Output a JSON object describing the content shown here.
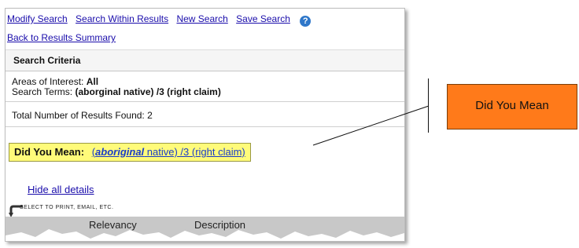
{
  "toolbar": {
    "modify_search": "Modify Search",
    "search_within": "Search Within Results",
    "new_search": "New Search",
    "save_search": "Save Search",
    "help_glyph": "?"
  },
  "back_link": "Back to Results Summary",
  "criteria": {
    "heading": "Search Criteria",
    "areas_label": "Areas of Interest:",
    "areas_value": "All",
    "terms_label": "Search Terms:",
    "terms_value": "(aborginal native) /3 (right claim)"
  },
  "results": {
    "total_text": "Total Number of Results Found: 2"
  },
  "did_you_mean": {
    "label": "Did You Mean:",
    "suggestion_open": "(",
    "corrected_word": "aboriginal",
    "suggestion_rest": " native) /3 (right claim)"
  },
  "hide_details": "Hide all details",
  "select_hint": "SELECT TO PRINT, EMAIL, ETC.",
  "grid_headers": {
    "relevancy": "Relevancy",
    "description": "Description"
  },
  "callout": {
    "text": "Did You Mean"
  },
  "colors": {
    "link": "#1a0dab",
    "highlight": "#fffb7a",
    "callout": "#ff7a1a"
  },
  "icons": [
    "help-icon",
    "select-arrow-icon"
  ]
}
